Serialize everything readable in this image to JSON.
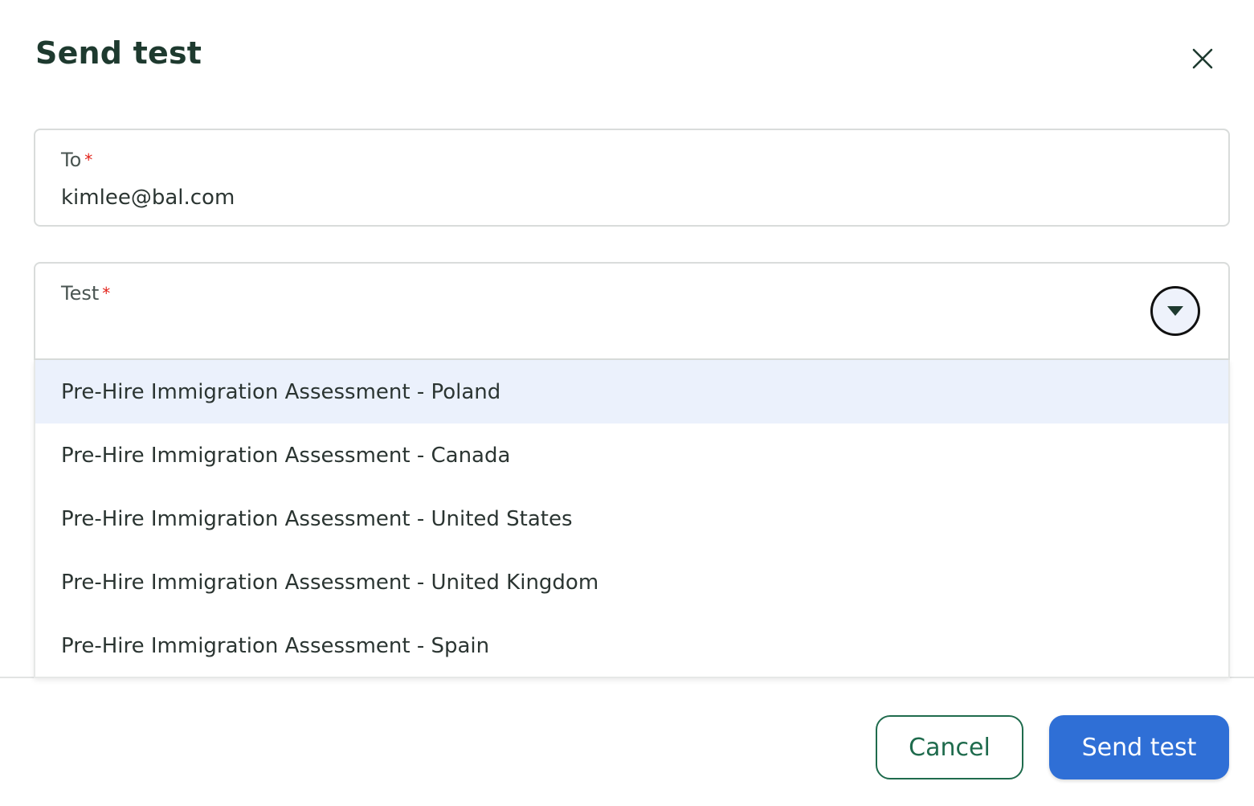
{
  "dialog": {
    "title": "Send test",
    "close_icon": "close-icon"
  },
  "to_field": {
    "label": "To",
    "required_mark": "*",
    "value": "kimlee@bal.com"
  },
  "test_field": {
    "label": "Test",
    "required_mark": "*",
    "value": "",
    "toggle_icon": "caret-down-icon",
    "options": [
      "Pre-Hire Immigration Assessment - Poland",
      "Pre-Hire Immigration Assessment - Canada",
      "Pre-Hire Immigration Assessment - United States",
      "Pre-Hire Immigration Assessment - United Kingdom",
      "Pre-Hire Immigration Assessment - Spain"
    ],
    "highlighted_index": 0
  },
  "footer": {
    "cancel_label": "Cancel",
    "send_label": "Send test"
  },
  "colors": {
    "title": "#1e3a2f",
    "required": "#e2231a",
    "primary": "#2f6fd6",
    "cancel": "#1f6b4d",
    "highlight": "#ebf1fc"
  }
}
